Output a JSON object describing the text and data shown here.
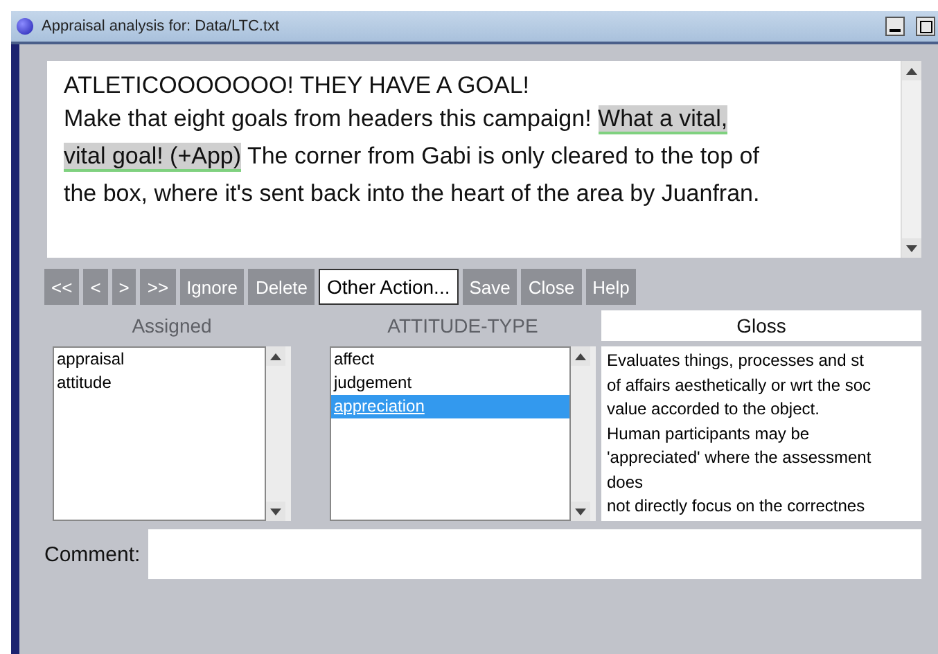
{
  "window": {
    "title": "Appraisal analysis for: Data/LTC.txt"
  },
  "text": {
    "lines": [
      [
        {
          "text": "ATLETICOOOOOOO! THEY HAVE A GOAL!",
          "highlighted": false
        }
      ],
      [
        {
          "text": "Make that eight goals from headers this campaign! ",
          "highlighted": false
        },
        {
          "text": "What a vital,",
          "highlighted": true
        }
      ],
      [
        {
          "text": "vital goal! (+App)",
          "highlighted": true
        },
        {
          "text": " The corner from Gabi is only cleared to the top of",
          "highlighted": false
        }
      ],
      [
        {
          "text": "the box, where it's sent back into the heart of the area by Juanfran.",
          "highlighted": false
        }
      ]
    ]
  },
  "buttons": [
    {
      "label": "<<",
      "disabled": true
    },
    {
      "label": "<",
      "disabled": true
    },
    {
      "label": ">",
      "disabled": true
    },
    {
      "label": ">>",
      "disabled": true
    },
    {
      "label": "Ignore",
      "disabled": true
    },
    {
      "label": "Delete",
      "disabled": true
    },
    {
      "label": "Other Action...",
      "disabled": false
    },
    {
      "label": "Save",
      "disabled": true
    },
    {
      "label": "Close",
      "disabled": true
    },
    {
      "label": "Help",
      "disabled": true
    }
  ],
  "assigned": {
    "label": "Assigned",
    "items": [
      {
        "label": "appraisal",
        "selected": false
      },
      {
        "label": "attitude",
        "selected": false
      }
    ]
  },
  "attitude_type": {
    "label": "ATTITUDE-TYPE",
    "items": [
      {
        "label": "affect",
        "selected": false
      },
      {
        "label": "judgement",
        "selected": false
      },
      {
        "label": "appreciation",
        "selected": true
      }
    ]
  },
  "gloss": {
    "label": "Gloss",
    "lines": [
      "Evaluates things, processes and st",
      "of affairs aesthetically or wrt the soc",
      "value accorded to the object.",
      "Human participants may be",
      "'appreciated' where the assessment",
      "does",
      "not directly focus on the correctnes"
    ]
  },
  "comment": {
    "label": "Comment:"
  }
}
